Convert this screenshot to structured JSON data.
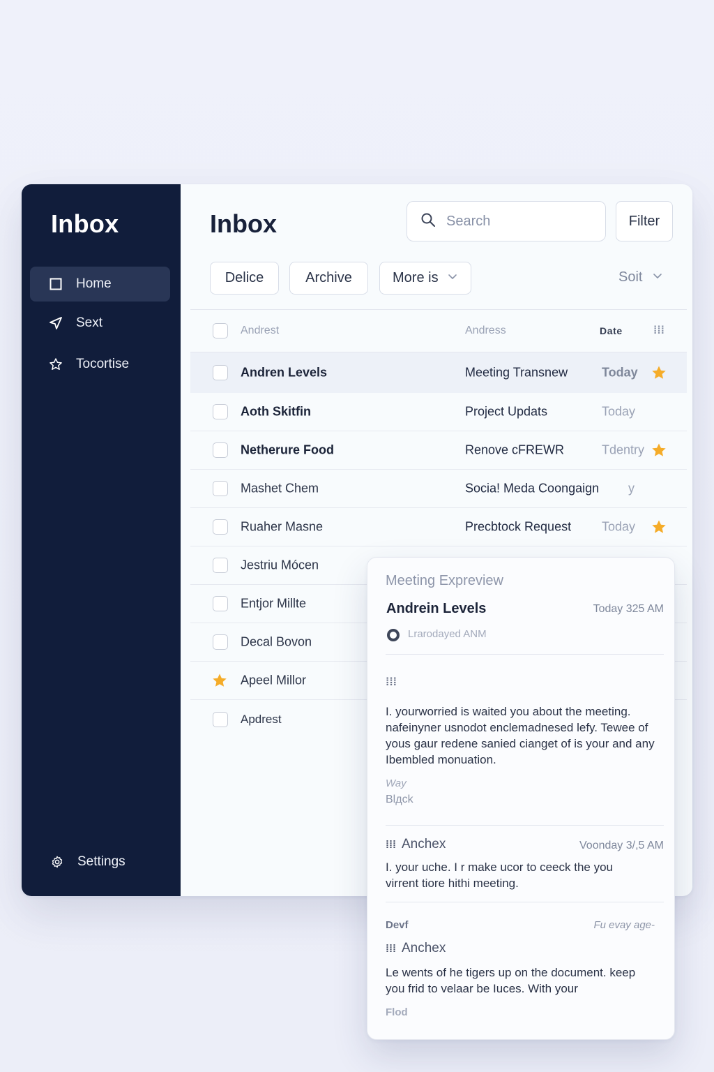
{
  "sidebar": {
    "title": "Inbox",
    "items": [
      {
        "label": "Home",
        "icon": "square-icon",
        "active": true
      },
      {
        "label": "Sext",
        "icon": "send-icon"
      },
      {
        "label": "Tocortise",
        "icon": "star-outline-icon"
      }
    ],
    "settings_label": "Settings"
  },
  "header": {
    "title": "Inbox",
    "search_placeholder": "Search",
    "filter_label": "Filter"
  },
  "toolbar": {
    "delete_label": "Delice",
    "archive_label": "Archive",
    "more_label": "More is",
    "sort_label": "Soit"
  },
  "table": {
    "headers": {
      "from": "Andrest",
      "subject": "Andress",
      "date": "Date",
      "extra": "⁞⁞⁞"
    },
    "rows": [
      {
        "from": "Andren Levels",
        "subject": "Meeting Transnew",
        "date": "Today",
        "starred": true
      },
      {
        "from": "Aoth Skitfin",
        "subject": "Project Updats",
        "date": "Today",
        "starred": false
      },
      {
        "from": "Netherure Food",
        "subject": "Renove cFREWR",
        "date": "Tdentry",
        "starred": true
      },
      {
        "from": "Mashet Chem",
        "subject": "Socia! Meda Coongaign",
        "date": "y",
        "starred": false
      },
      {
        "from": "Ruaher Masne",
        "subject": "Precbtock Request",
        "date": "Today",
        "starred": true
      },
      {
        "from": "Jestriu Mócen",
        "subject": "",
        "date": "",
        "starred": false
      },
      {
        "from": "Entjor Millte",
        "subject": "",
        "date": "",
        "starred": false
      },
      {
        "from": "Decal Bovon",
        "subject": "",
        "date": "",
        "starred": false
      },
      {
        "from": "Apeel Millor",
        "subject": "",
        "date": "",
        "starred": false,
        "lead_star": true
      },
      {
        "from": "Apdrest",
        "subject": "",
        "date": "",
        "starred": false
      }
    ]
  },
  "preview": {
    "heading": "Meeting Expreview",
    "from": "Andrein Levels",
    "time": "Today 325 AM",
    "status": "Lrarodayed ANM",
    "grid_glyph": "⁞⁞⁞",
    "body": "I. yourworried is waited you about the meeting. nafeinyner usnodot enclemadnesed lefy. Tewee of yous gaur redene sanied cianget of is your and any Ibembled monuation.",
    "note": "Way",
    "sign": "Blдck",
    "reply1": {
      "sender": "Anchex",
      "time": "Voonday 3/,5 AM",
      "body": "I. your uche. I r make ucor to ceeck the you virrent tiore hithi meeting."
    },
    "reply2": {
      "label": "Devf",
      "stamp": "Fu evay age-",
      "sender": "Anchex",
      "body": "Le wents of he tigers up on the document. keep you frid to velaar be Iuces. With your",
      "foot": "Flod"
    }
  },
  "colors": {
    "sidebar_bg": "#111d3b",
    "sidebar_active": "#293656",
    "star": "#f5ac29",
    "page_bg": "#eef0f9"
  }
}
